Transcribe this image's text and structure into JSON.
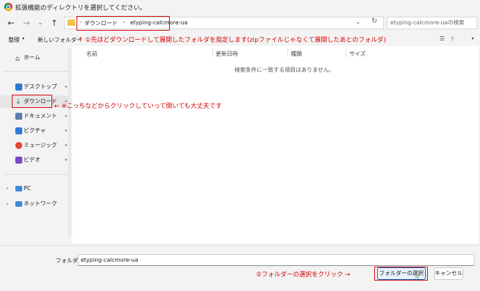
{
  "window": {
    "title": "拡張機能のディレクトリを選択してください。"
  },
  "nav": {
    "back": "←",
    "forward": "→",
    "dropdown": "⌄",
    "up": "↑"
  },
  "address": {
    "segments": [
      "ダウンロード",
      "etyping-calcmore-ua"
    ],
    "refresh": "↻",
    "chevron": "⌄"
  },
  "search": {
    "placeholder": "etyping-calcmore-uaの検索"
  },
  "toolbar": {
    "organize": "整理",
    "new_folder": "新しいフォルダー"
  },
  "sidebar": {
    "home": "ホーム",
    "items": [
      {
        "label": "デスクトップ",
        "color": "#2a7ad1"
      },
      {
        "label": "ダウンロード",
        "color": "#1a8f3c"
      },
      {
        "label": "ドキュメント",
        "color": "#5b7fa8"
      },
      {
        "label": "ピクチャ",
        "color": "#2f7bd6"
      },
      {
        "label": "ミュージック",
        "color": "#e04a30"
      },
      {
        "label": "ビデオ",
        "color": "#7b47c4"
      }
    ],
    "pc": "PC",
    "network": "ネットワーク"
  },
  "columns": [
    "名前",
    "更新日時",
    "種類",
    "サイズ"
  ],
  "empty_message": "検索条件に一致する項目はありません。",
  "annotations": {
    "note1": "↑ ①先ほどダウンロードして展開したフォルダを指定します(zipファイルじゃなくて展開したあとのフォルダ)",
    "note2": "← ※こっちなどからクリックしていって開いても大丈夫です",
    "note3": "②フォルダーの選択をクリック →"
  },
  "footer": {
    "folder_label": "フォルダー:",
    "folder_value": "etyping-calcmore-ua",
    "select_button": "フォルダーの選択",
    "cancel_button": "キャンセル"
  }
}
